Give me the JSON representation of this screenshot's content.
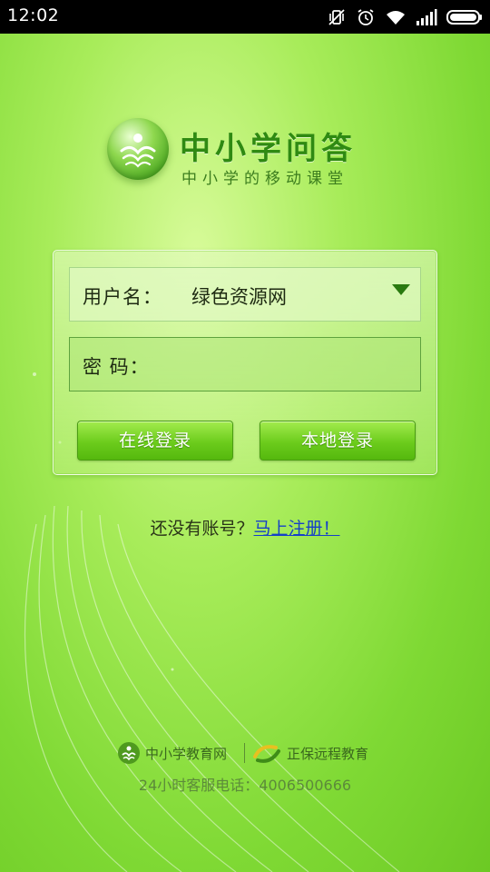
{
  "status_bar": {
    "time": "12:02",
    "icons": [
      "vibrate-mute-icon",
      "alarm-icon",
      "wifi-icon",
      "signal-icon",
      "battery-icon"
    ]
  },
  "app": {
    "title": "中小学问答",
    "subtitle": "中小学的移动课堂"
  },
  "login": {
    "username_label": "用户名：",
    "username_value": "绿色资源网",
    "password_label": "密 码：",
    "online_login": "在线登录",
    "local_login": "本地登录"
  },
  "register": {
    "prompt": "还没有账号？",
    "link": "马上注册！"
  },
  "footer": {
    "brand_1": "中小学教育网",
    "brand_2": "正保远程教育",
    "hotline": "24小时客服电话：4006500666"
  },
  "colors": {
    "background": "#8ee040",
    "title": "#2f8a12",
    "button": "#6ccc1c",
    "link": "#1640c8"
  }
}
